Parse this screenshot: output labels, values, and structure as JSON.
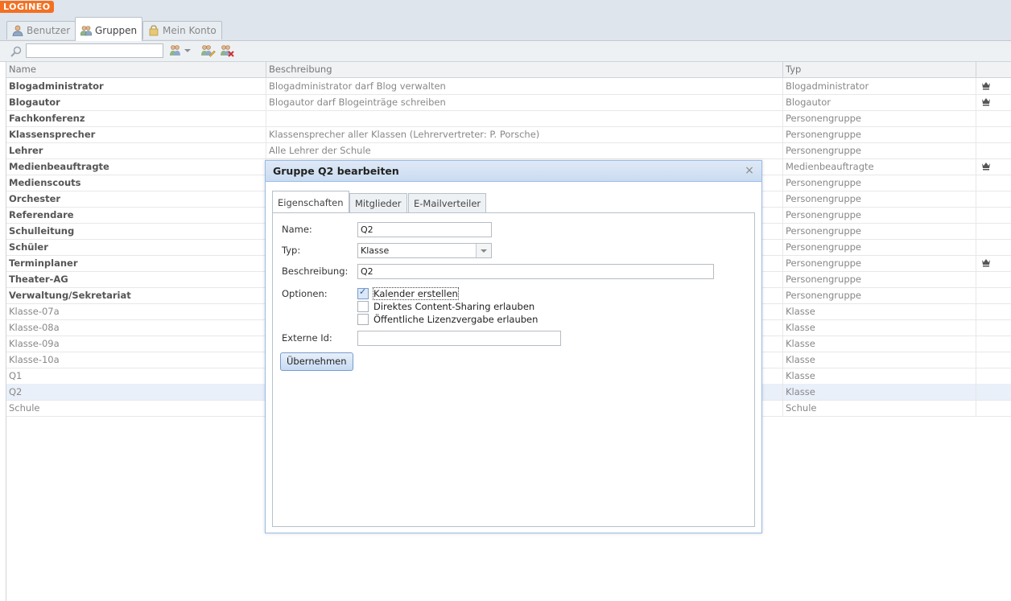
{
  "app": {
    "logo": "LOGINEO"
  },
  "tabs": [
    {
      "label": "Benutzer",
      "icon": "user-icon"
    },
    {
      "label": "Gruppen",
      "icon": "group-icon"
    },
    {
      "label": "Mein Konto",
      "icon": "account-icon"
    }
  ],
  "toolbar": {
    "search_value": "",
    "icons": [
      "add-group-icon",
      "edit-group-icon",
      "delete-group-icon"
    ]
  },
  "grid": {
    "columns": [
      "Name",
      "Beschreibung",
      "Typ",
      ""
    ],
    "rows": [
      {
        "name": "Blogadministrator",
        "desc": "Blogadministrator darf Blog verwalten",
        "type": "Blogadministrator",
        "crown": true,
        "bold": true
      },
      {
        "name": "Blogautor",
        "desc": "Blogautor darf Blogeinträge schreiben",
        "type": "Blogautor",
        "crown": true,
        "bold": true
      },
      {
        "name": "Fachkonferenz",
        "desc": "",
        "type": "Personengruppe",
        "crown": false,
        "bold": true
      },
      {
        "name": "Klassensprecher",
        "desc": "Klassensprecher aller Klassen (Lehrervertreter: P. Porsche)",
        "type": "Personengruppe",
        "crown": false,
        "bold": true
      },
      {
        "name": "Lehrer",
        "desc": "Alle Lehrer der Schule",
        "type": "Personengruppe",
        "crown": false,
        "bold": true
      },
      {
        "name": "Medienbeauftragte",
        "desc": "",
        "type": "Medienbeauftragte",
        "crown": true,
        "bold": true
      },
      {
        "name": "Medienscouts",
        "desc": "",
        "type": "Personengruppe",
        "crown": false,
        "bold": true
      },
      {
        "name": "Orchester",
        "desc": "",
        "type": "Personengruppe",
        "crown": false,
        "bold": true
      },
      {
        "name": "Referendare",
        "desc": "",
        "type": "Personengruppe",
        "crown": false,
        "bold": true
      },
      {
        "name": "Schulleitung",
        "desc": "",
        "type": "Personengruppe",
        "crown": false,
        "bold": true
      },
      {
        "name": "Schüler",
        "desc": "",
        "type": "Personengruppe",
        "crown": false,
        "bold": true
      },
      {
        "name": "Terminplaner",
        "desc": "",
        "type": "Personengruppe",
        "crown": true,
        "bold": true
      },
      {
        "name": "Theater-AG",
        "desc": "",
        "type": "Personengruppe",
        "crown": false,
        "bold": true
      },
      {
        "name": "Verwaltung/Sekretariat",
        "desc": "",
        "type": "Personengruppe",
        "crown": false,
        "bold": true
      },
      {
        "name": "Klasse-07a",
        "desc": "",
        "type": "Klasse",
        "crown": false,
        "bold": false
      },
      {
        "name": "Klasse-08a",
        "desc": "",
        "type": "Klasse",
        "crown": false,
        "bold": false
      },
      {
        "name": "Klasse-09a",
        "desc": "",
        "type": "Klasse",
        "crown": false,
        "bold": false
      },
      {
        "name": "Klasse-10a",
        "desc": "",
        "type": "Klasse",
        "crown": false,
        "bold": false
      },
      {
        "name": "Q1",
        "desc": "",
        "type": "Klasse",
        "crown": false,
        "bold": false
      },
      {
        "name": "Q2",
        "desc": "",
        "type": "Klasse",
        "crown": false,
        "bold": false,
        "selected": true
      },
      {
        "name": "Schule",
        "desc": "",
        "type": "Schule",
        "crown": false,
        "bold": false
      }
    ]
  },
  "dialog": {
    "title": "Gruppe Q2 bearbeiten",
    "close": "×",
    "tabs": [
      "Eigenschaften",
      "Mitglieder",
      "E-Mailverteiler"
    ],
    "labels": {
      "name": "Name:",
      "typ": "Typ:",
      "beschreibung": "Beschreibung:",
      "optionen": "Optionen:",
      "externe_id": "Externe Id:"
    },
    "values": {
      "name": "Q2",
      "typ": "Klasse",
      "beschreibung": "Q2",
      "externe_id": ""
    },
    "options": [
      {
        "label": "Kalender erstellen",
        "checked": true
      },
      {
        "label": "Direktes Content-Sharing erlauben",
        "checked": false
      },
      {
        "label": "Öffentliche Lizenzvergabe erlauben",
        "checked": false
      }
    ],
    "submit": "Übernehmen"
  },
  "colors": {
    "logo": "#f37021",
    "dialog_border": "#99bbe8",
    "selected_row": "#e9f0f9"
  }
}
